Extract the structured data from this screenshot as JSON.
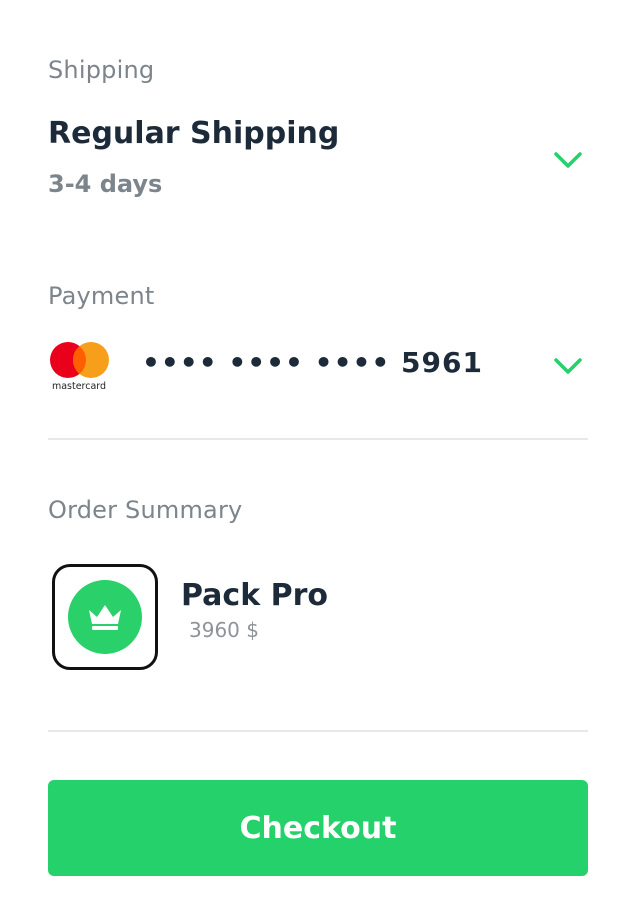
{
  "colors": {
    "accent": "#25d16b",
    "text_primary": "#1c2a39",
    "text_muted": "#7c858c",
    "divider": "#e6e9ec"
  },
  "shipping": {
    "label": "Shipping",
    "method": "Regular Shipping",
    "eta": "3-4 days",
    "chevron_icon": "chevron-down-icon"
  },
  "payment": {
    "label": "Payment",
    "card_brand": "mastercard",
    "card_number": "•••• •••• •••• 5961",
    "chevron_icon": "chevron-down-icon"
  },
  "order_summary": {
    "label": "Order Summary",
    "item": {
      "icon": "crown-icon",
      "name": "Pack Pro",
      "price": "3960 $"
    }
  },
  "checkout": {
    "label": "Checkout"
  }
}
